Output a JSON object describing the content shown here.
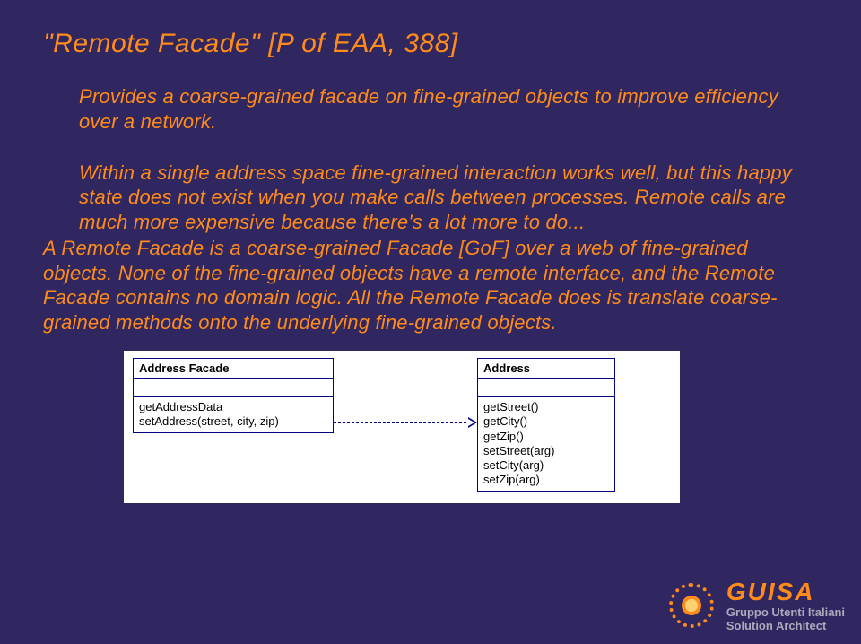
{
  "title": "\"Remote Facade\" [P of EAA, 388]",
  "para1": "Provides a coarse-grained facade on fine-grained objects to improve efficiency over a network.",
  "para2": "Within a single address space fine-grained interaction works well, but this happy state does not exist when you make calls between processes. Remote calls are much more expensive because there's a lot more to do...",
  "para3": "A Remote Facade is a coarse-grained Facade [GoF] over a web of fine-grained objects. None of the fine-grained objects have a remote interface, and the Remote Facade contains no domain logic. All the Remote Facade does is translate coarse-grained methods onto the underlying fine-grained objects.",
  "uml": {
    "facade": {
      "name": "Address Facade",
      "methods": [
        "getAddressData",
        "setAddress(street, city, zip)"
      ]
    },
    "address": {
      "name": "Address",
      "methods": [
        "getStreet()",
        "getCity()",
        "getZip()",
        "setStreet(arg)",
        "setCity(arg)",
        "setZip(arg)"
      ]
    }
  },
  "footer": {
    "brand": "GUISA",
    "line1": "Gruppo Utenti Italiani",
    "line2": "Solution Architect"
  }
}
